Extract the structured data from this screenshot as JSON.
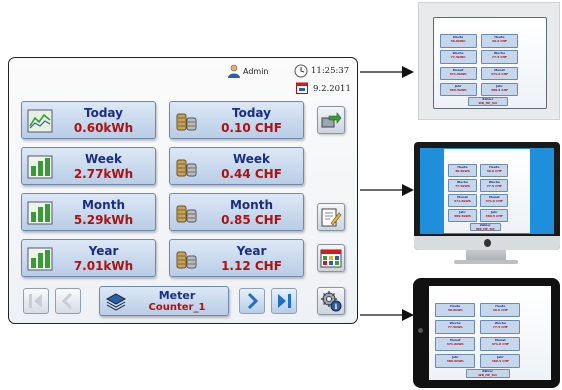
{
  "header": {
    "user": "Admin",
    "time": "11:25:37",
    "date": "9.2.2011"
  },
  "tiles": [
    {
      "label": "Today",
      "value": "0.60kWh"
    },
    {
      "label": "Today",
      "value": "0.10 CHF"
    },
    {
      "label": "Week",
      "value": "2.77kWh"
    },
    {
      "label": "Week",
      "value": "0.44 CHF"
    },
    {
      "label": "Month",
      "value": "5.29kWh"
    },
    {
      "label": "Month",
      "value": "0.85 CHF"
    },
    {
      "label": "Year",
      "value": "7.01kWh"
    },
    {
      "label": "Year",
      "value": "1.12 CHF"
    }
  ],
  "meter": {
    "label": "Meter",
    "name": "Counter_1"
  },
  "icons": {
    "chart": "line-chart-icon",
    "bars": "bar-chart-icon",
    "coins": "coins-icon",
    "export": "export-icon",
    "edit": "edit-icon",
    "calendar": "calendar-grid-icon",
    "settings": "settings-icon"
  },
  "colors": {
    "tile_top": "#dce8f6",
    "tile_bottom": "#b9cde6",
    "label": "#1a2d8a",
    "value": "#b01010",
    "tablet_bg": "#1f8fdb"
  },
  "previews": [
    {
      "device": "small-panel",
      "tiles": [
        "Heute",
        "30.6kWh",
        "Heute",
        "30.6 CHF",
        "Woche",
        "77.5kWh",
        "Woche",
        "77.5 CHF",
        "Monat",
        "371.6kWh",
        "Monat",
        "371.6 CHF",
        "Jahr",
        "389.5kWh",
        "Jahr",
        "389.5 CHF"
      ],
      "meter": "Zähler",
      "meter_name": "WR_HP_Tot"
    },
    {
      "device": "monitor",
      "tiles": [
        "Heute",
        "30.6kWh",
        "Heute",
        "30.6 CHF",
        "Woche",
        "77.5kWh",
        "Woche",
        "77.5 CHF",
        "Monat",
        "371.6kWh",
        "Monat",
        "371.6 CHF",
        "Jahr",
        "389.5kWh",
        "Jahr",
        "389.5 CHF"
      ],
      "meter": "Zähler",
      "meter_name": "WR_HP_Tot"
    },
    {
      "device": "tablet",
      "tiles": [
        "Heute",
        "30.6kWh",
        "Heute",
        "30.6 CHF",
        "Woche",
        "77.5kWh",
        "Woche",
        "77.5 CHF",
        "Monat",
        "371.6kWh",
        "Monat",
        "371.6 CHF",
        "Jahr",
        "389.5kWh",
        "Jahr",
        "389.5 CHF"
      ],
      "meter": "Zähler",
      "meter_name": "WR_HP_Tot"
    }
  ]
}
